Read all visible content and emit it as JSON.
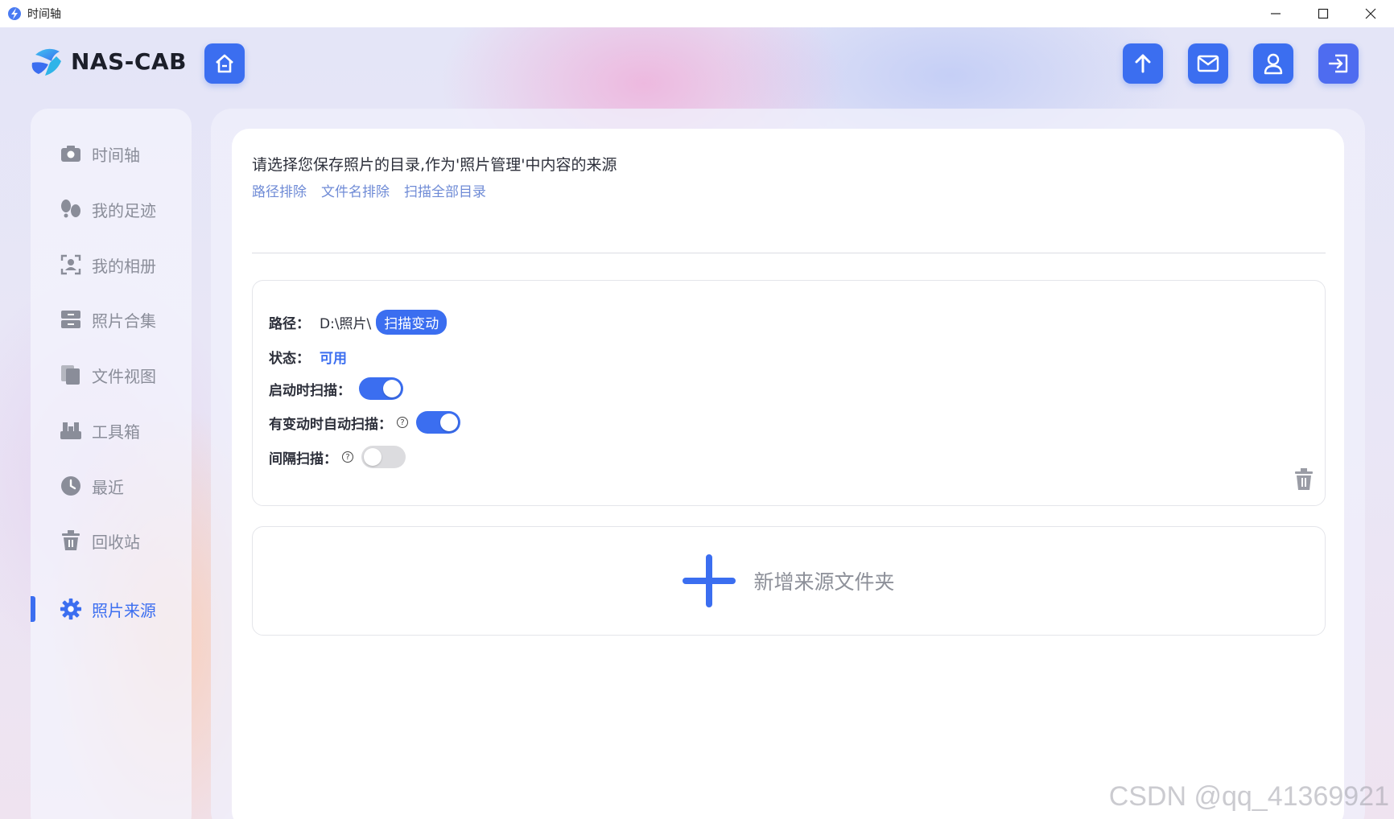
{
  "window": {
    "title": "时间轴",
    "controls": [
      "minimize-icon",
      "maximize-icon",
      "close-icon"
    ]
  },
  "brand": {
    "name": "NAS-CAB"
  },
  "header": {
    "buttons": [
      "home-icon",
      "upload-icon",
      "mail-icon",
      "user-icon",
      "logout-icon"
    ]
  },
  "sidebar": {
    "items": [
      {
        "label": "时间轴",
        "icon": "camera-icon",
        "active": false
      },
      {
        "label": "我的足迹",
        "icon": "footprints-icon",
        "active": false
      },
      {
        "label": "我的相册",
        "icon": "face-album-icon",
        "active": false
      },
      {
        "label": "照片合集",
        "icon": "archive-icon",
        "active": false
      },
      {
        "label": "文件视图",
        "icon": "files-icon",
        "active": false
      },
      {
        "label": "工具箱",
        "icon": "toolbox-icon",
        "active": false
      },
      {
        "label": "最近",
        "icon": "clock-icon",
        "active": false
      },
      {
        "label": "回收站",
        "icon": "trash-icon",
        "active": false
      },
      {
        "label": "照片来源",
        "icon": "gear-icon",
        "active": true
      }
    ]
  },
  "main": {
    "description": "请选择您保存照片的目录,作为'照片管理'中内容的来源",
    "links": [
      "路径排除",
      "文件名排除",
      "扫描全部目录"
    ],
    "source": {
      "path_label": "路径：",
      "path_value": "D:\\照片\\",
      "scan_button": "扫描变动",
      "status_label": "状态：",
      "status_value": "可用",
      "scan_on_start_label": "启动时扫描：",
      "scan_on_start": true,
      "auto_scan_label": "有变动时自动扫描：",
      "auto_scan": true,
      "interval_scan_label": "间隔扫描：",
      "interval_scan": false
    },
    "add_folder_label": "新增来源文件夹"
  },
  "watermark": "CSDN @qq_41369921",
  "colors": {
    "accent": "#3b6ef0",
    "link": "#6f8bd6",
    "muted": "#8a8d99"
  }
}
